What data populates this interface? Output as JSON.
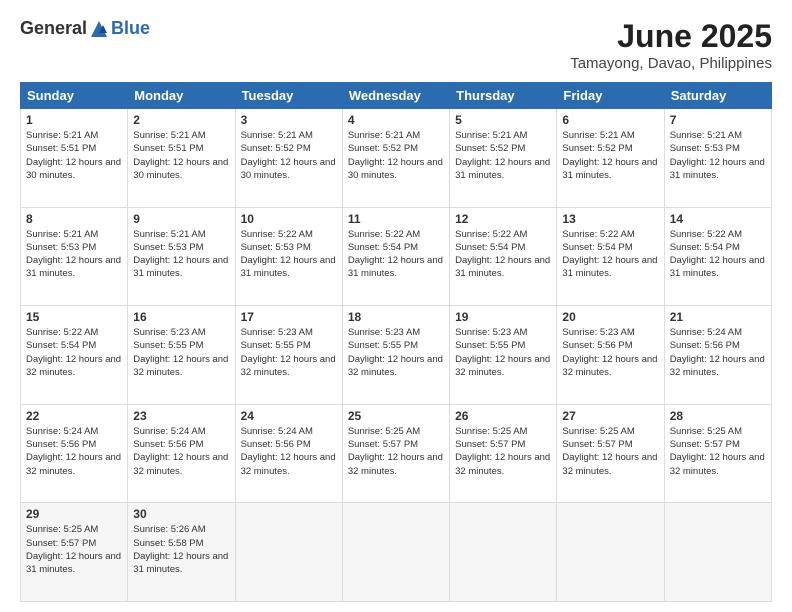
{
  "logo": {
    "general": "General",
    "blue": "Blue"
  },
  "title": "June 2025",
  "subtitle": "Tamayong, Davao, Philippines",
  "days_header": [
    "Sunday",
    "Monday",
    "Tuesday",
    "Wednesday",
    "Thursday",
    "Friday",
    "Saturday"
  ],
  "weeks": [
    [
      {
        "num": "1",
        "sunrise": "5:21 AM",
        "sunset": "5:51 PM",
        "daylight": "12 hours and 30 minutes."
      },
      {
        "num": "2",
        "sunrise": "5:21 AM",
        "sunset": "5:51 PM",
        "daylight": "12 hours and 30 minutes."
      },
      {
        "num": "3",
        "sunrise": "5:21 AM",
        "sunset": "5:52 PM",
        "daylight": "12 hours and 30 minutes."
      },
      {
        "num": "4",
        "sunrise": "5:21 AM",
        "sunset": "5:52 PM",
        "daylight": "12 hours and 30 minutes."
      },
      {
        "num": "5",
        "sunrise": "5:21 AM",
        "sunset": "5:52 PM",
        "daylight": "12 hours and 31 minutes."
      },
      {
        "num": "6",
        "sunrise": "5:21 AM",
        "sunset": "5:52 PM",
        "daylight": "12 hours and 31 minutes."
      },
      {
        "num": "7",
        "sunrise": "5:21 AM",
        "sunset": "5:53 PM",
        "daylight": "12 hours and 31 minutes."
      }
    ],
    [
      {
        "num": "8",
        "sunrise": "5:21 AM",
        "sunset": "5:53 PM",
        "daylight": "12 hours and 31 minutes."
      },
      {
        "num": "9",
        "sunrise": "5:21 AM",
        "sunset": "5:53 PM",
        "daylight": "12 hours and 31 minutes."
      },
      {
        "num": "10",
        "sunrise": "5:22 AM",
        "sunset": "5:53 PM",
        "daylight": "12 hours and 31 minutes."
      },
      {
        "num": "11",
        "sunrise": "5:22 AM",
        "sunset": "5:54 PM",
        "daylight": "12 hours and 31 minutes."
      },
      {
        "num": "12",
        "sunrise": "5:22 AM",
        "sunset": "5:54 PM",
        "daylight": "12 hours and 31 minutes."
      },
      {
        "num": "13",
        "sunrise": "5:22 AM",
        "sunset": "5:54 PM",
        "daylight": "12 hours and 31 minutes."
      },
      {
        "num": "14",
        "sunrise": "5:22 AM",
        "sunset": "5:54 PM",
        "daylight": "12 hours and 31 minutes."
      }
    ],
    [
      {
        "num": "15",
        "sunrise": "5:22 AM",
        "sunset": "5:54 PM",
        "daylight": "12 hours and 32 minutes."
      },
      {
        "num": "16",
        "sunrise": "5:23 AM",
        "sunset": "5:55 PM",
        "daylight": "12 hours and 32 minutes."
      },
      {
        "num": "17",
        "sunrise": "5:23 AM",
        "sunset": "5:55 PM",
        "daylight": "12 hours and 32 minutes."
      },
      {
        "num": "18",
        "sunrise": "5:23 AM",
        "sunset": "5:55 PM",
        "daylight": "12 hours and 32 minutes."
      },
      {
        "num": "19",
        "sunrise": "5:23 AM",
        "sunset": "5:55 PM",
        "daylight": "12 hours and 32 minutes."
      },
      {
        "num": "20",
        "sunrise": "5:23 AM",
        "sunset": "5:56 PM",
        "daylight": "12 hours and 32 minutes."
      },
      {
        "num": "21",
        "sunrise": "5:24 AM",
        "sunset": "5:56 PM",
        "daylight": "12 hours and 32 minutes."
      }
    ],
    [
      {
        "num": "22",
        "sunrise": "5:24 AM",
        "sunset": "5:56 PM",
        "daylight": "12 hours and 32 minutes."
      },
      {
        "num": "23",
        "sunrise": "5:24 AM",
        "sunset": "5:56 PM",
        "daylight": "12 hours and 32 minutes."
      },
      {
        "num": "24",
        "sunrise": "5:24 AM",
        "sunset": "5:56 PM",
        "daylight": "12 hours and 32 minutes."
      },
      {
        "num": "25",
        "sunrise": "5:25 AM",
        "sunset": "5:57 PM",
        "daylight": "12 hours and 32 minutes."
      },
      {
        "num": "26",
        "sunrise": "5:25 AM",
        "sunset": "5:57 PM",
        "daylight": "12 hours and 32 minutes."
      },
      {
        "num": "27",
        "sunrise": "5:25 AM",
        "sunset": "5:57 PM",
        "daylight": "12 hours and 32 minutes."
      },
      {
        "num": "28",
        "sunrise": "5:25 AM",
        "sunset": "5:57 PM",
        "daylight": "12 hours and 32 minutes."
      }
    ],
    [
      {
        "num": "29",
        "sunrise": "5:25 AM",
        "sunset": "5:57 PM",
        "daylight": "12 hours and 31 minutes."
      },
      {
        "num": "30",
        "sunrise": "5:26 AM",
        "sunset": "5:58 PM",
        "daylight": "12 hours and 31 minutes."
      },
      null,
      null,
      null,
      null,
      null
    ]
  ]
}
